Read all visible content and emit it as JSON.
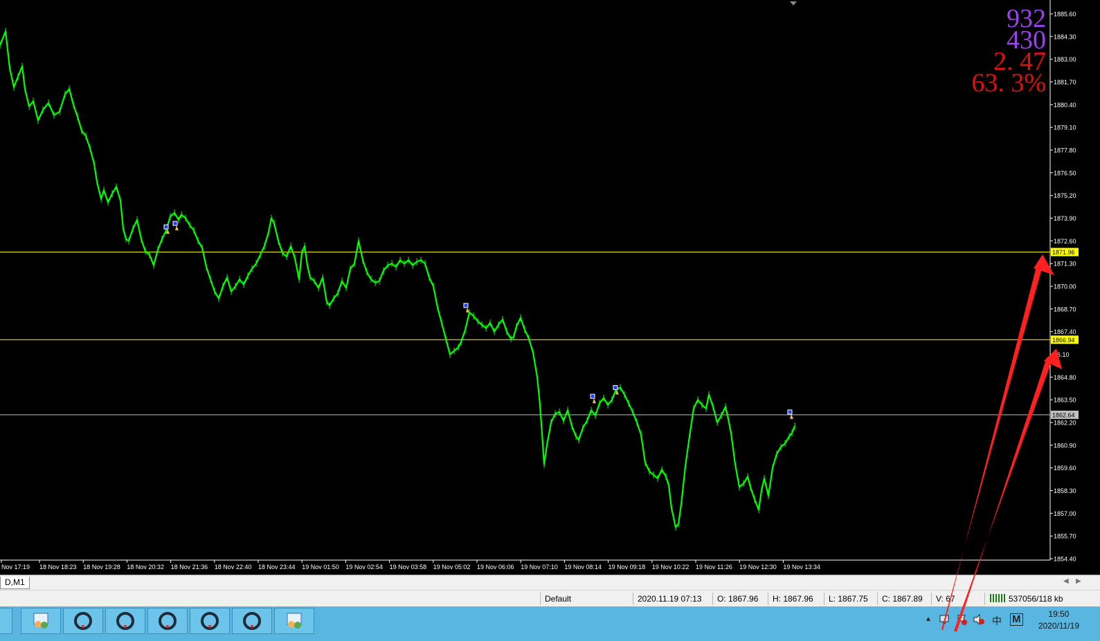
{
  "indicator": {
    "line1": "932",
    "line2": "430",
    "line3": "2. 47",
    "line4": "63. 3%",
    "color_purple": "#9b42e8",
    "color_red": "#e01010"
  },
  "chart_data": {
    "type": "line",
    "symbol_timeframe": "D,M1",
    "price_min": 1854.4,
    "price_max": 1885.6,
    "y_ticks": [
      "1885.60",
      "1884.30",
      "1883.00",
      "1881.70",
      "1880.40",
      "1879.10",
      "1877.80",
      "1876.50",
      "1875.20",
      "1873.90",
      "1872.60",
      "1871.30",
      "1870.00",
      "1868.70",
      "1867.40",
      "66.10",
      "1864.80",
      "1863.50",
      "1862.20",
      "1860.90",
      "1859.60",
      "1858.30",
      "1857.00",
      "1855.70",
      "1854.40"
    ],
    "x_ticks": [
      "Nov 17:19",
      "18 Nov 18:23",
      "18 Nov 19:28",
      "18 Nov 20:32",
      "18 Nov 21:36",
      "18 Nov 22:40",
      "18 Nov 23:44",
      "19 Nov 01:50",
      "19 Nov 02:54",
      "19 Nov 03:58",
      "19 Nov 05:02",
      "19 Nov 06:06",
      "19 Nov 07:10",
      "19 Nov 08:14",
      "19 Nov 09:18",
      "19 Nov 10:22",
      "19 Nov 11:26",
      "19 Nov 12:30",
      "19 Nov 13:34"
    ],
    "level_lines": [
      {
        "price": 1871.96,
        "label": "1871.96",
        "color": "#ffff00"
      },
      {
        "price": 1866.94,
        "label": "1866.94",
        "color": "#ffff00"
      },
      {
        "price": 1862.64,
        "label": "1862.64",
        "color": "#c0c0c0"
      }
    ],
    "x": [
      0,
      8,
      14,
      20,
      26,
      32,
      36,
      42,
      48,
      55,
      62,
      70,
      78,
      86,
      94,
      100,
      106,
      112,
      118,
      124,
      130,
      136,
      140,
      146,
      150,
      156,
      162,
      168,
      174,
      178,
      182,
      186,
      192,
      198,
      204,
      210,
      216,
      222,
      228,
      234,
      240,
      246,
      252,
      258,
      262,
      268,
      274,
      280,
      286,
      292,
      298,
      304,
      310,
      316,
      322,
      328,
      334,
      340,
      346,
      352,
      358,
      364,
      370,
      376,
      382,
      388,
      392,
      396,
      402,
      408,
      414,
      420,
      426,
      432,
      436,
      440,
      444,
      448,
      454,
      460,
      466,
      472,
      476,
      482,
      488,
      494,
      500,
      506,
      512,
      518,
      524,
      530,
      536,
      542,
      548,
      554,
      560,
      566,
      572,
      578,
      584,
      590,
      596,
      602,
      608,
      614,
      620,
      626,
      632,
      638,
      644,
      650,
      656,
      662,
      666,
      672,
      678,
      684,
      690,
      696,
      702,
      708,
      714,
      720,
      726,
      732,
      738,
      742,
      746,
      752,
      758,
      764,
      770,
      776,
      780,
      784,
      786,
      790,
      796,
      802,
      808,
      814,
      820,
      826,
      832,
      836,
      842,
      848,
      854,
      860,
      866,
      872,
      878,
      884,
      890,
      896,
      902,
      908,
      914,
      920,
      926,
      932,
      938,
      944,
      950,
      956,
      962,
      966,
      970,
      976,
      980,
      984,
      990,
      996,
      1002,
      1008,
      1014,
      1020,
      1024,
      1030,
      1036,
      1042,
      1048,
      1052,
      1056,
      1062,
      1068,
      1074,
      1080,
      1084,
      1090,
      1096,
      1100,
      1104,
      1110,
      1116,
      1122,
      1128,
      1134,
      1140,
      1144,
      1148
    ],
    "y": [
      1883.8,
      1884.6,
      1882.5,
      1881.4,
      1882.0,
      1882.6,
      1881.3,
      1880.3,
      1880.6,
      1879.5,
      1880.1,
      1880.5,
      1879.8,
      1880.0,
      1881.0,
      1881.3,
      1880.4,
      1879.7,
      1878.9,
      1878.6,
      1877.9,
      1877.0,
      1876.0,
      1875.0,
      1875.5,
      1874.8,
      1875.3,
      1875.7,
      1874.9,
      1873.3,
      1872.7,
      1872.6,
      1873.3,
      1873.8,
      1872.7,
      1872.0,
      1871.8,
      1871.2,
      1872.1,
      1872.7,
      1873.2,
      1874.0,
      1874.2,
      1873.8,
      1874.1,
      1873.9,
      1873.5,
      1873.2,
      1872.6,
      1872.2,
      1871.1,
      1870.4,
      1869.7,
      1869.3,
      1870.0,
      1870.5,
      1869.7,
      1870.0,
      1870.4,
      1870.1,
      1870.6,
      1871.0,
      1871.3,
      1871.8,
      1872.3,
      1873.1,
      1873.9,
      1873.6,
      1872.6,
      1871.9,
      1871.7,
      1872.3,
      1871.6,
      1870.4,
      1871.9,
      1872.3,
      1871.2,
      1870.5,
      1870.3,
      1869.9,
      1870.5,
      1869.1,
      1868.9,
      1869.3,
      1869.6,
      1870.3,
      1869.9,
      1871.0,
      1871.3,
      1872.6,
      1871.5,
      1870.8,
      1870.4,
      1870.2,
      1870.3,
      1870.9,
      1871.2,
      1871.3,
      1871.1,
      1871.5,
      1871.3,
      1871.5,
      1871.2,
      1871.4,
      1871.5,
      1871.3,
      1870.5,
      1870.0,
      1868.8,
      1867.9,
      1867.0,
      1866.1,
      1866.3,
      1866.5,
      1866.8,
      1867.5,
      1868.5,
      1868.3,
      1868.0,
      1867.8,
      1867.6,
      1867.9,
      1867.4,
      1867.8,
      1868.1,
      1867.4,
      1867.0,
      1867.1,
      1867.7,
      1868.2,
      1867.5,
      1867.0,
      1866.2,
      1864.8,
      1863.2,
      1861.0,
      1859.8,
      1860.9,
      1862.2,
      1862.7,
      1862.8,
      1862.3,
      1862.9,
      1862.0,
      1861.4,
      1861.2,
      1861.9,
      1862.3,
      1862.9,
      1862.6,
      1863.3,
      1863.6,
      1863.2,
      1863.5,
      1864.1,
      1864.2,
      1863.8,
      1863.3,
      1862.8,
      1862.2,
      1861.5,
      1859.9,
      1859.4,
      1859.2,
      1859.0,
      1859.5,
      1859.1,
      1858.6,
      1857.3,
      1856.2,
      1856.4,
      1857.5,
      1859.7,
      1861.4,
      1863.0,
      1863.5,
      1863.2,
      1863.0,
      1863.8,
      1863.1,
      1862.2,
      1862.6,
      1863.1,
      1862.4,
      1861.6,
      1859.8,
      1858.5,
      1858.7,
      1859.1,
      1858.5,
      1857.8,
      1857.2,
      1858.3,
      1859.0,
      1858.0,
      1859.6,
      1860.4,
      1860.8,
      1861.0,
      1861.4,
      1861.6,
      1862.0,
      1862.4,
      1863.3
    ],
    "trade_markers": [
      {
        "x": 240,
        "price": 1873.4
      },
      {
        "x": 253,
        "price": 1873.6
      },
      {
        "x": 673,
        "price": 1868.9
      },
      {
        "x": 856,
        "price": 1863.7
      },
      {
        "x": 889,
        "price": 1864.2
      },
      {
        "x": 1141,
        "price": 1862.8
      }
    ],
    "series_color": "#00ff00"
  },
  "symbol_tab": {
    "label": "D,M1"
  },
  "statusbar": {
    "profile": "Default",
    "datetime": "2020.11.19 07:13",
    "open": "O: 1867.96",
    "high": "H: 1867.96",
    "low": "L: 1867.75",
    "close": "C: 1867.89",
    "volume": "V: 67",
    "traffic": "537056/118 kb"
  },
  "taskbar": {
    "tray_ime": "中",
    "tray_m": "M",
    "clock_time": "19:50",
    "clock_date": "2020/11/19"
  }
}
